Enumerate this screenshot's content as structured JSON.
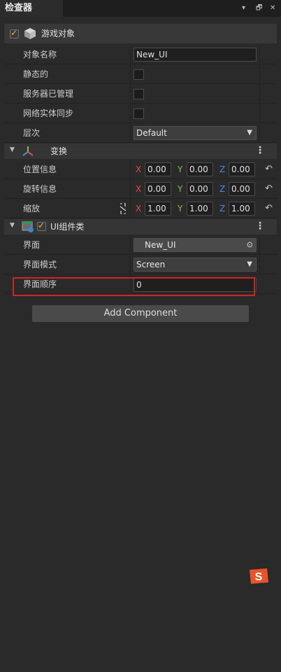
{
  "panel": {
    "tab_title": "检查器",
    "pin_icon": "▾",
    "popout_icon": "🗗",
    "close_icon": "✕"
  },
  "gameobject": {
    "title": "游戏对象",
    "enabled": true
  },
  "fields": {
    "name_label": "对象名称",
    "name_value": "New_UI",
    "static_label": "静态的",
    "server_label": "服务器已管理",
    "net_label": "网络实体同步",
    "layer_label": "层次",
    "layer_value": "Default"
  },
  "transform": {
    "title": "变换",
    "position_label": "位置信息",
    "position": {
      "x": "0.00",
      "y": "0.00",
      "z": "0.00"
    },
    "rotation_label": "旋转信息",
    "rotation": {
      "x": "0.00",
      "y": "0.00",
      "z": "0.00"
    },
    "scale_label": "缩放",
    "scale": {
      "x": "1.00",
      "y": "1.00",
      "z": "1.00"
    },
    "axis_x": "X",
    "axis_y": "Y",
    "axis_z": "Z"
  },
  "ui_component": {
    "title": "UI组件类",
    "enabled": true,
    "ui_label": "界面",
    "ui_value": "New_UI",
    "mode_label": "界面模式",
    "mode_value": "Screen",
    "order_label": "界面顺序",
    "order_value": "0"
  },
  "add_component_label": "Add Component",
  "colors": {
    "accent": "#f2b233",
    "highlight": "#d12323",
    "x_axis": "#e04a4a",
    "y_axis": "#7cc04a",
    "z_axis": "#4a88e0"
  },
  "ime_badge": "S"
}
